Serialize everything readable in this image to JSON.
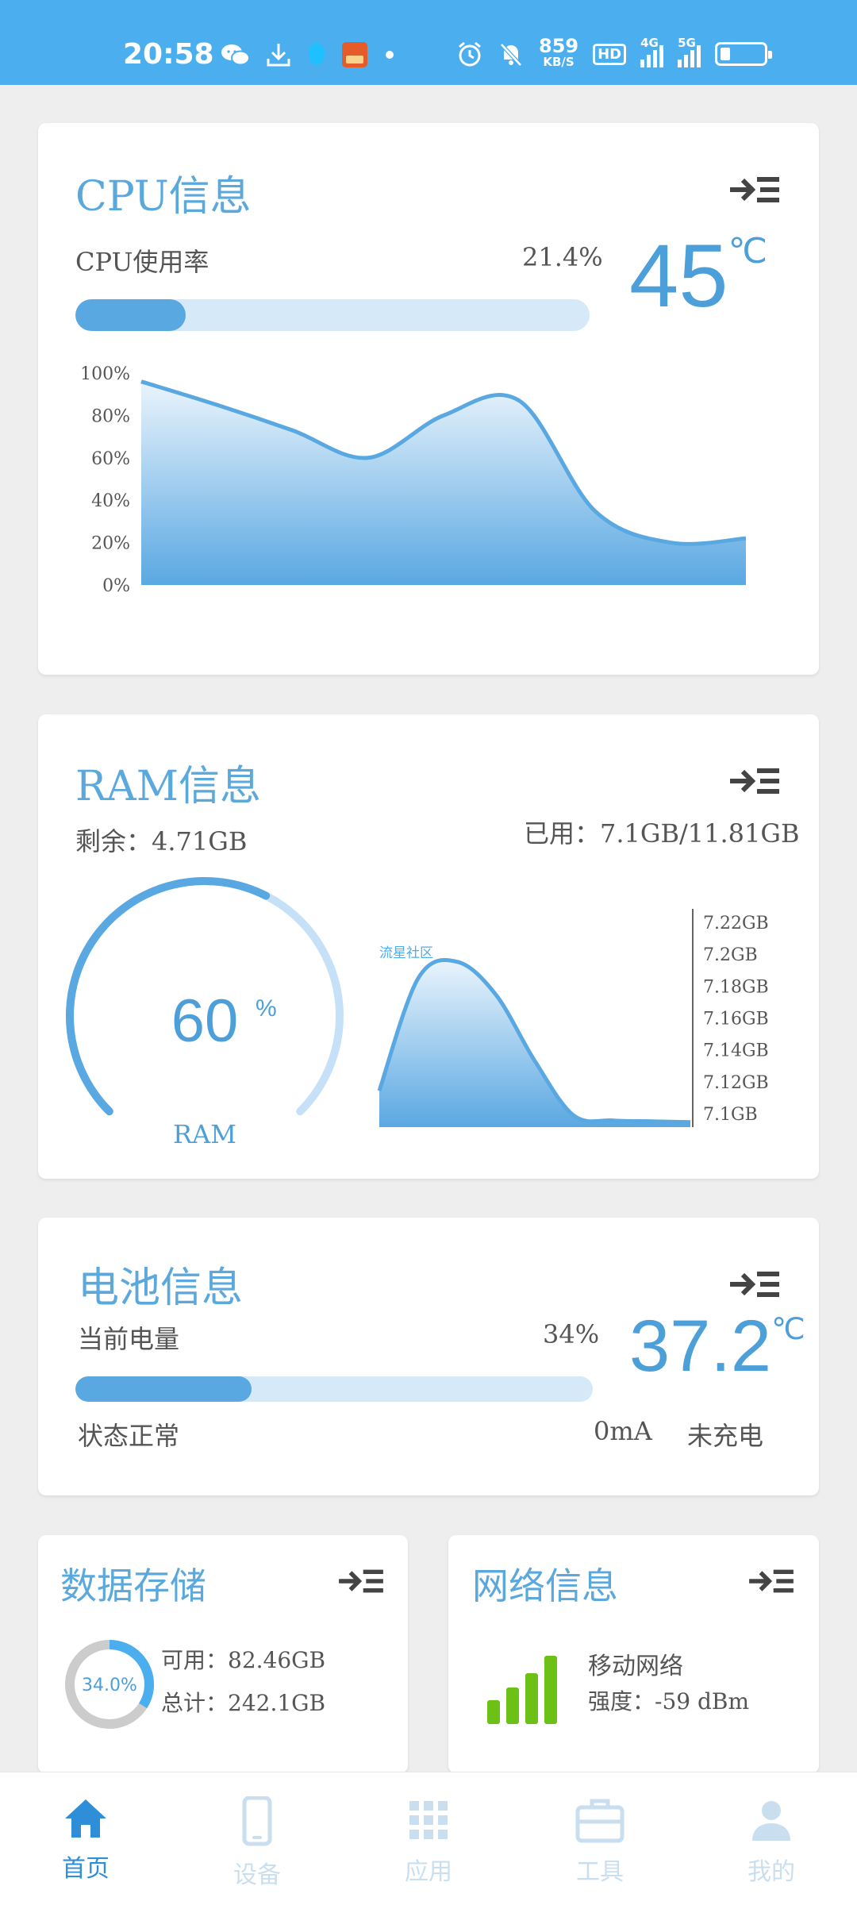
{
  "status_bar": {
    "time": "20:58",
    "speed_value": "859",
    "speed_unit": "KB/S",
    "hd_badge": "HD",
    "net1": "4G",
    "net2": "5G",
    "battery_level": 0.2
  },
  "cpu": {
    "title": "CPU信息",
    "usage_label": "CPU使用率",
    "usage_value": "21.4%",
    "usage_fraction": 0.214,
    "temperature": "45",
    "temp_unit": "℃",
    "chart_ticks": [
      "100%",
      "80%",
      "60%",
      "40%",
      "20%",
      "0%"
    ]
  },
  "ram": {
    "title": "RAM信息",
    "remaining_label": "剩余：",
    "remaining_value": "4.71GB",
    "used_label": "已用：",
    "used_value": "7.1GB/11.81GB",
    "percent": "60",
    "percent_unit": "%",
    "gauge_label": "RAM",
    "gauge_fraction": 0.6,
    "watermark": "流星社区",
    "chart_ticks": [
      "7.22GB",
      "7.2GB",
      "7.18GB",
      "7.16GB",
      "7.14GB",
      "7.12GB",
      "7.1GB"
    ]
  },
  "battery": {
    "title": "电池信息",
    "level_label": "当前电量",
    "level_value": "34%",
    "level_fraction": 0.34,
    "temperature": "37.2",
    "temp_unit": "℃",
    "status": "状态正常",
    "current": "0mA",
    "charging": "未充电"
  },
  "storage": {
    "title": "数据存储",
    "percent": "34.0%",
    "fraction": 0.34,
    "available_label": "可用：",
    "available_value": "82.46GB",
    "total_label": "总计：",
    "total_value": "242.1GB"
  },
  "network": {
    "title": "网络信息",
    "type": "移动网络",
    "strength_label": "强度：",
    "strength_value": "-59 dBm"
  },
  "nav": [
    {
      "label": "首页"
    },
    {
      "label": "设备"
    },
    {
      "label": "应用"
    },
    {
      "label": "工具"
    },
    {
      "label": "我的"
    }
  ],
  "colors": {
    "accent": "#4aaeef",
    "chart_blue": "#5aa8e2",
    "light_blue": "#d5e9f8",
    "signal_green": "#6cc016"
  },
  "chart_data": [
    {
      "type": "area",
      "title": "CPU",
      "x": [
        0,
        1,
        2,
        3,
        4,
        5,
        6,
        7,
        8
      ],
      "values": [
        96,
        85,
        73,
        60,
        80,
        87,
        35,
        20,
        22
      ],
      "ylim": [
        0,
        100
      ],
      "y_unit": "%",
      "grid": false
    },
    {
      "type": "area",
      "title": "RAM",
      "x": [
        0,
        1,
        2,
        3,
        4,
        5,
        6,
        7,
        8
      ],
      "values": [
        7.122,
        7.19,
        7.2,
        7.18,
        7.14,
        7.107,
        7.104,
        7.1035,
        7.103
      ],
      "ylim": [
        7.1,
        7.22
      ],
      "y_unit": "GB",
      "grid": false
    }
  ]
}
